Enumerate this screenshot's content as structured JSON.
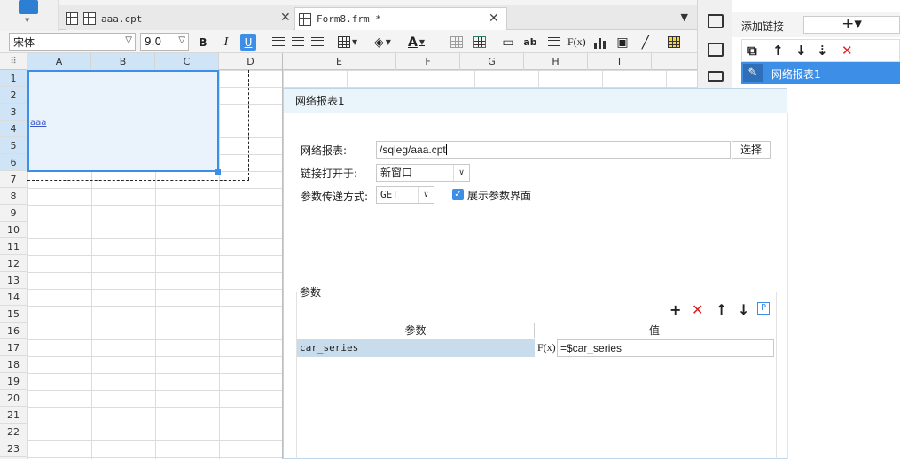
{
  "tabs": [
    {
      "label": "aaa.cpt"
    },
    {
      "label": "Form8.frm *"
    }
  ],
  "toolbar": {
    "font_name": "宋体",
    "font_size": "9.0",
    "bold": "B",
    "italic": "I",
    "underline": "U",
    "text_abbrev": "ab",
    "formula": "F(x)",
    "font_color_letter": "A"
  },
  "sheet": {
    "columns": [
      "A",
      "B",
      "C",
      "D",
      "E",
      "F",
      "G",
      "H",
      "I"
    ],
    "rows": [
      "1",
      "2",
      "3",
      "4",
      "5",
      "6",
      "7",
      "8",
      "9",
      "10",
      "11",
      "12",
      "13",
      "14",
      "15",
      "16",
      "17",
      "18",
      "19",
      "20",
      "21",
      "22",
      "23"
    ],
    "cell_link_text": "aaa"
  },
  "link_panel": {
    "add_link_label": "添加链接",
    "add_link_button": "+▾",
    "items": [
      {
        "label": "网络报表1"
      }
    ]
  },
  "dialog": {
    "title": "网络报表1",
    "report_label": "网络报表:",
    "report_path": "/sqleg/aaa.cpt",
    "choose_button": "选择",
    "open_in_label": "链接打开于:",
    "open_in_value": "新窗口",
    "pass_method_label": "参数传递方式:",
    "pass_method_value": "GET",
    "show_params_label": "展示参数界面",
    "show_params_checked": true,
    "params_title": "参数",
    "params_columns": [
      "参数",
      "值"
    ],
    "params_rows": [
      {
        "name": "car_series",
        "formula_label": "F(x)",
        "value": "=$car_series"
      }
    ],
    "params_p_button": "P"
  },
  "colors": {
    "accent": "#3d8ee6",
    "delete": "#e02020",
    "selection_fill": "#eaf3fc",
    "param_row": "#c9dceb"
  }
}
